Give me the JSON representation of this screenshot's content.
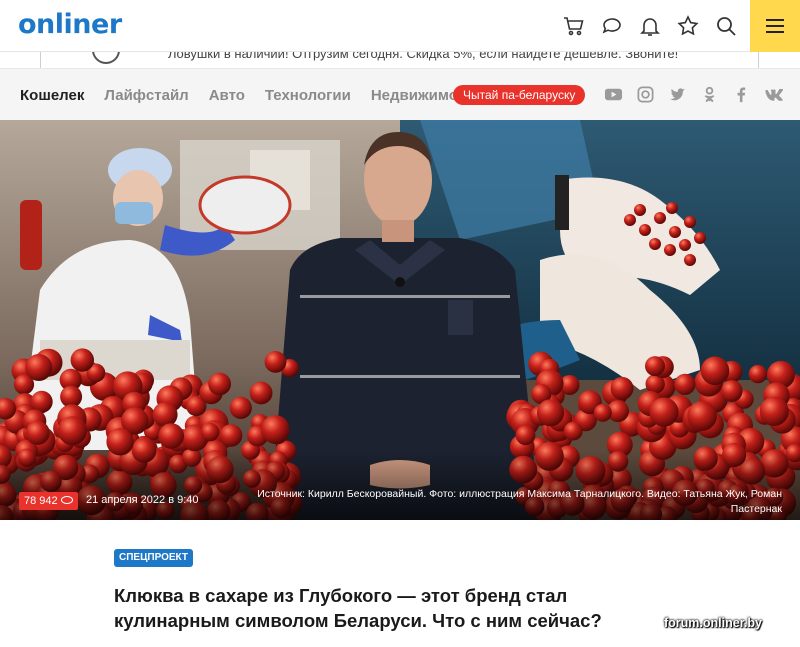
{
  "header": {
    "logo_main": "onliner",
    "icons": [
      "cart-icon",
      "chat-icon",
      "bell-icon",
      "star-icon",
      "search-icon"
    ],
    "menu_icon": "hamburger-menu-icon",
    "brand_color": "#1e78c8",
    "accent_color": "#e8322b",
    "menu_bg": "#ffd84d"
  },
  "ad": {
    "text": "Ловушки в наличии! Отгрузим сегодня. Скидка 5%, если найдете дешевле. Звоните!",
    "logo_fragment": "SC"
  },
  "nav": {
    "items": [
      {
        "label": "Кошелек",
        "active": true
      },
      {
        "label": "Лайфстайл",
        "active": false
      },
      {
        "label": "Авто",
        "active": false
      },
      {
        "label": "Технологии",
        "active": false
      },
      {
        "label": "Недвижимость",
        "active": false
      }
    ],
    "belarusian_button": "Чытай па-беларуску",
    "socials": [
      "youtube-icon",
      "instagram-icon",
      "twitter-icon",
      "odnoklassniki-icon",
      "facebook-icon",
      "vk-icon"
    ]
  },
  "hero": {
    "views": "78 942",
    "date": "21 апреля 2022 в 9:40",
    "credit": "Источник: Кирилл Бескоровайный. Фото: иллюстрация Максима Тарналицкого. Видео: Татьяна Жук, Роман Пастернак"
  },
  "article": {
    "badge": "СПЕЦПРОЕКТ",
    "headline": "Клюква в сахаре из Глубокого — этот бренд стал кулинарным символом Беларуси. Что с ним сейчас?",
    "watermark": "forum.onliner.by"
  }
}
